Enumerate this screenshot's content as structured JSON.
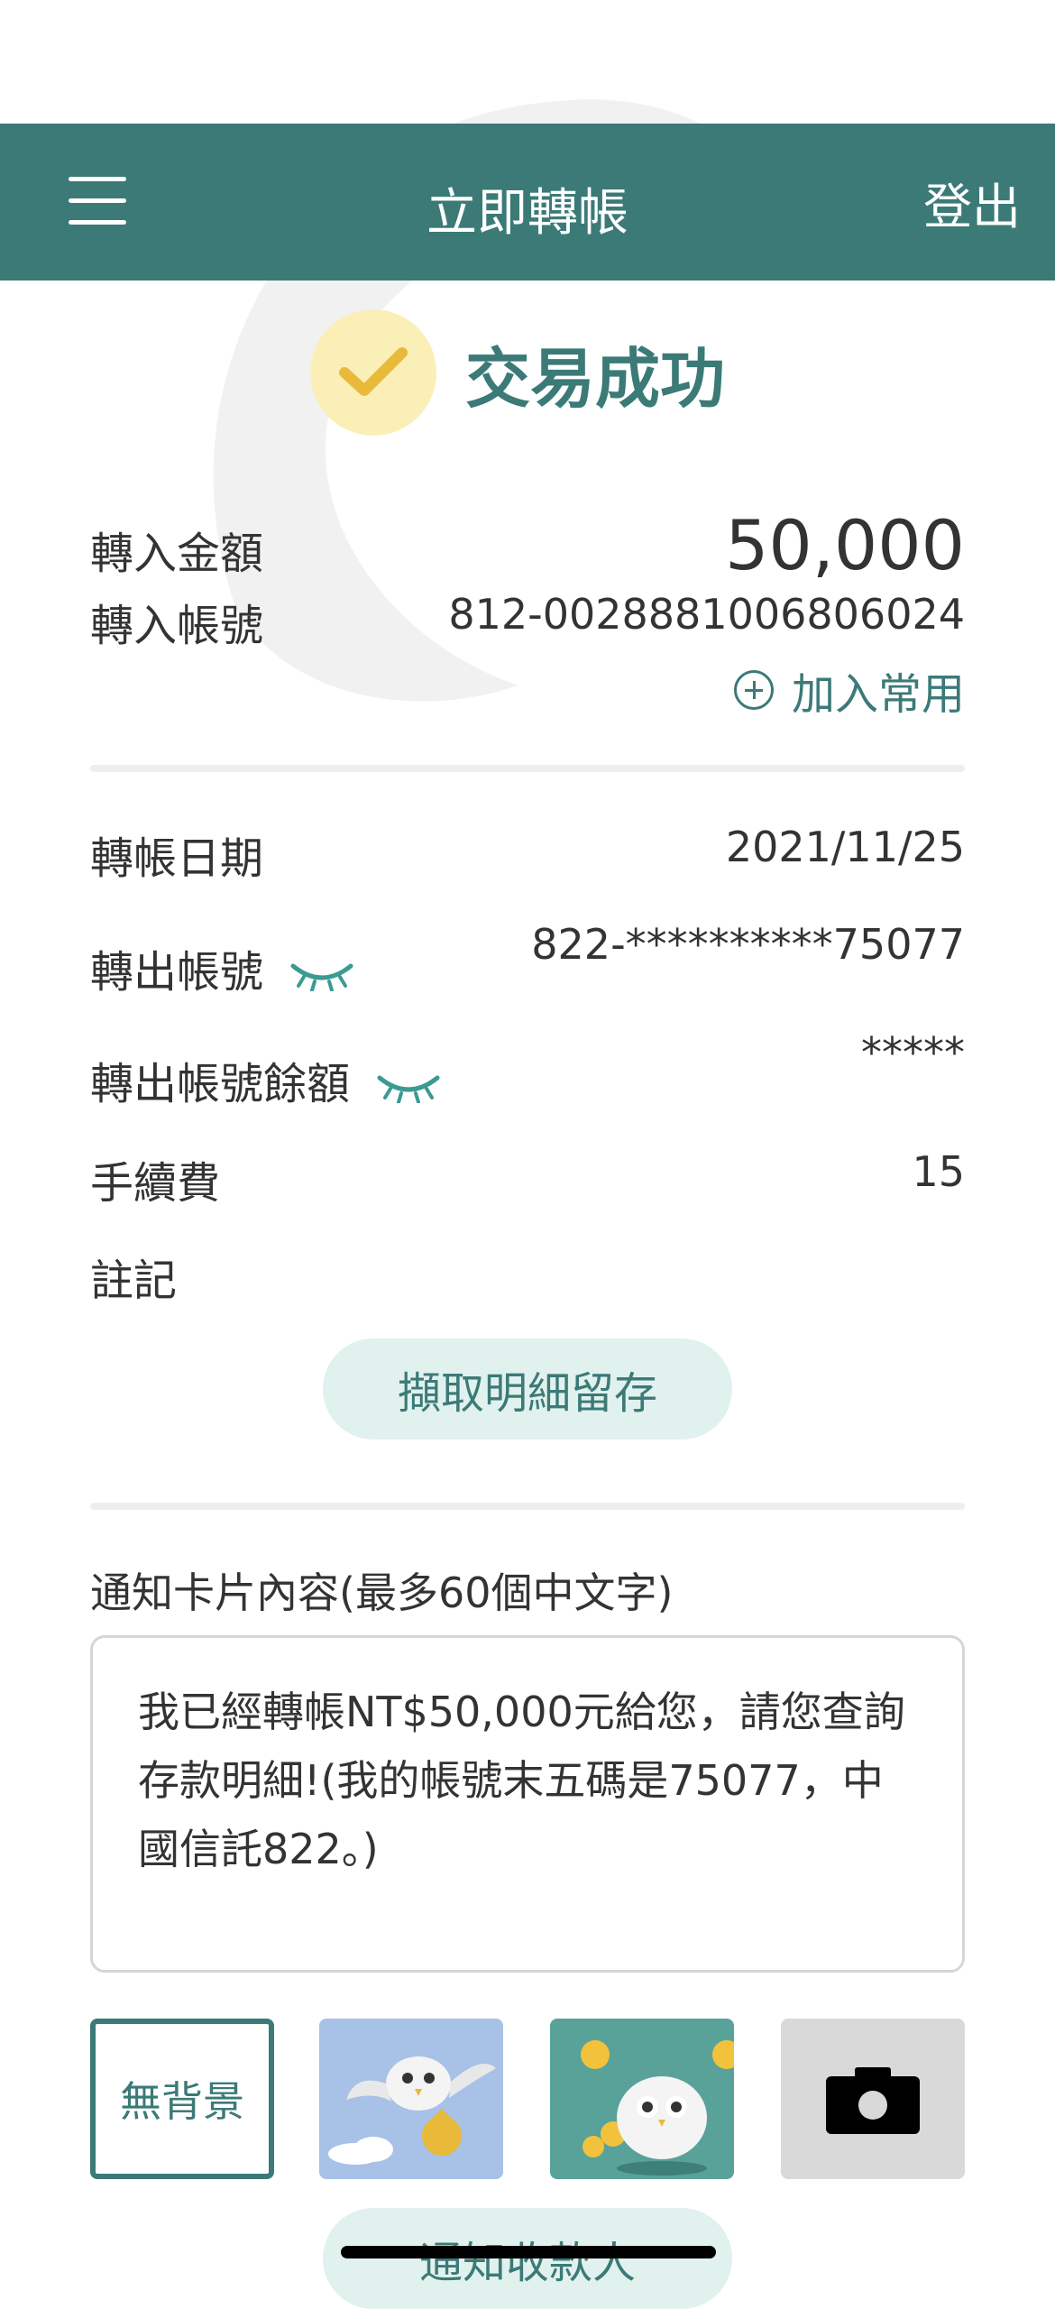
{
  "header": {
    "title": "立即轉帳",
    "logout_label": "登出"
  },
  "status": {
    "text": "交易成功"
  },
  "transfer_in": {
    "amount_label": "轉入金額",
    "amount_value": "50,000",
    "account_label": "轉入帳號",
    "account_value": "812-0028881006806024",
    "add_favorite_label": "加入常用"
  },
  "details": {
    "date_label": "轉帳日期",
    "date_value": "2021/11/25",
    "out_account_label": "轉出帳號",
    "out_account_value": "822-**********75077",
    "balance_label": "轉出帳號餘額",
    "balance_value": "*****",
    "fee_label": "手續費",
    "fee_value": "15",
    "note_label": "註記",
    "note_value": ""
  },
  "capture_button_label": "擷取明細留存",
  "notice": {
    "title": "通知卡片內容(最多60個中文字)",
    "message": "我已經轉帳NT$50,000元給您，請您查詢存款明細!(我的帳號末五碼是75077，中國信託822。)"
  },
  "backgrounds": {
    "none_label": "無背景"
  },
  "notify_button_label": "通知收款人",
  "colors": {
    "primary": "#3b7a77",
    "check_bg": "#fbefb8",
    "check_mark": "#e9b93a",
    "pill_bg": "#e1f1ee"
  }
}
